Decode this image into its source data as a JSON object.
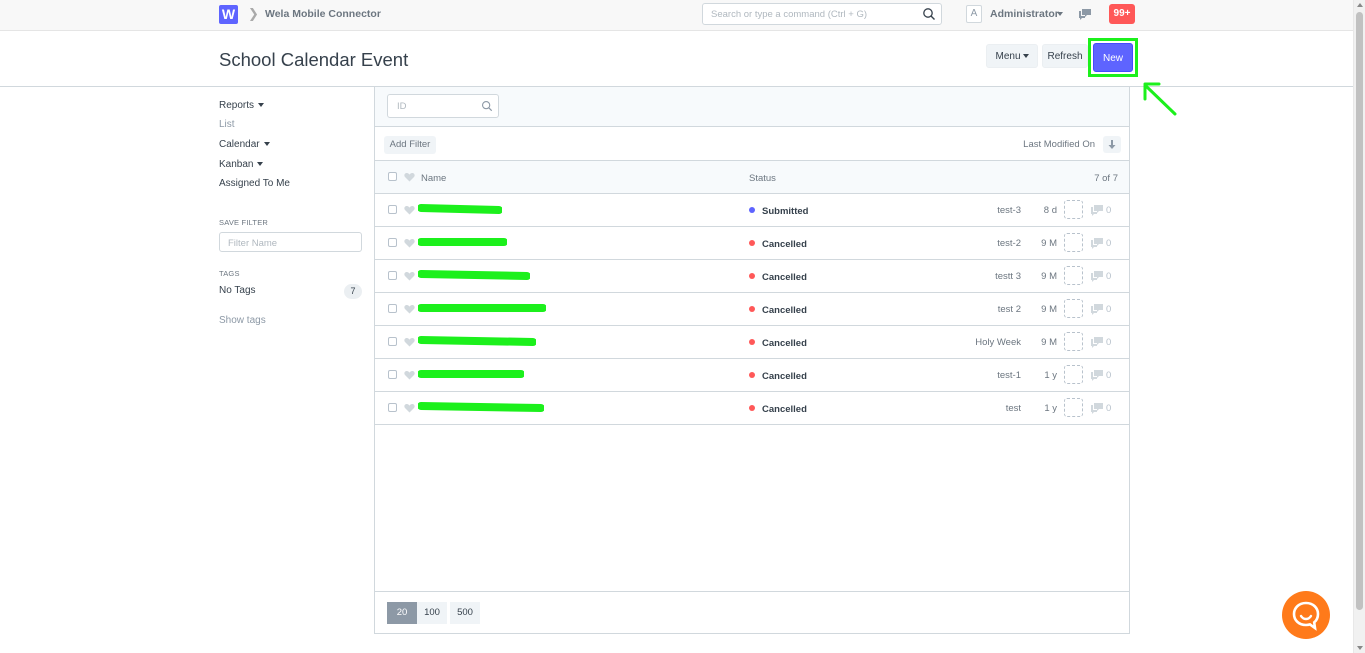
{
  "navbar": {
    "logo_letter": "W",
    "breadcrumb": "Wela Mobile Connector",
    "search_placeholder": "Search or type a command (Ctrl + G)",
    "avatar_letter": "A",
    "user_name": "Administrator",
    "notifications": "99+"
  },
  "page": {
    "title": "School Calendar Event",
    "menu_label": "Menu",
    "refresh_label": "Refresh",
    "new_label": "New"
  },
  "sidebar": {
    "reports": "Reports",
    "list": "List",
    "calendar": "Calendar",
    "kanban": "Kanban",
    "assigned": "Assigned To Me",
    "save_filter_head": "SAVE FILTER",
    "filter_placeholder": "Filter Name",
    "tags_head": "TAGS",
    "no_tags": "No Tags",
    "no_tags_count": "7",
    "show_tags": "Show tags"
  },
  "list": {
    "id_placeholder": "ID",
    "add_filter": "Add Filter",
    "sort_label": "Last Modified On",
    "col_name": "Name",
    "col_status": "Status",
    "count": "7 of 7",
    "rows": [
      {
        "status": "Submitted",
        "status_color": "#5e64ff",
        "title": "test-3",
        "modified": "8 d",
        "comments": "0"
      },
      {
        "status": "Cancelled",
        "status_color": "#ff5858",
        "title": "test-2",
        "modified": "9 M",
        "comments": "0"
      },
      {
        "status": "Cancelled",
        "status_color": "#ff5858",
        "title": "testt 3",
        "modified": "9 M",
        "comments": "0"
      },
      {
        "status": "Cancelled",
        "status_color": "#ff5858",
        "title": "test 2",
        "modified": "9 M",
        "comments": "0"
      },
      {
        "status": "Cancelled",
        "status_color": "#ff5858",
        "title": "Holy Week",
        "modified": "9 M",
        "comments": "0"
      },
      {
        "status": "Cancelled",
        "status_color": "#ff5858",
        "title": "test-1",
        "modified": "1 y",
        "comments": "0"
      },
      {
        "status": "Cancelled",
        "status_color": "#ff5858",
        "title": "test",
        "modified": "1 y",
        "comments": "0"
      }
    ],
    "page_sizes": [
      "20",
      "100",
      "500"
    ]
  },
  "colors": {
    "accent": "#5e64ff",
    "highlight": "#1cf01c",
    "chat": "#ff7a1a"
  }
}
